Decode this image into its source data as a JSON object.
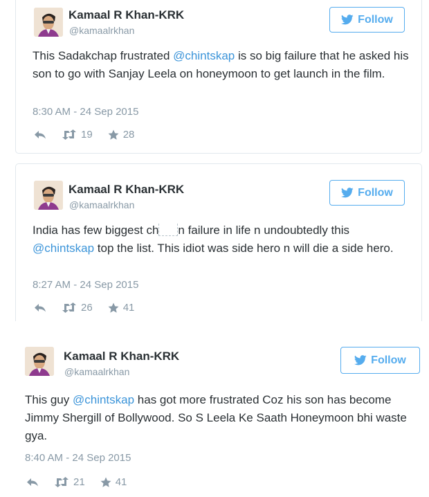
{
  "tweets": [
    {
      "author_name": "Kamaal R Khan-KRK",
      "handle": "@kamaalrkhan",
      "follow_label": "Follow",
      "text_parts": [
        "This Sadakchap frustrated ",
        "@chintskap",
        " is so big failure that he asked his son to go with Sanjay Leela on honeymoon to get launch in the film."
      ],
      "timestamp": "8:30 AM - 24 Sep 2015",
      "retweets": "19",
      "favorites": "28"
    },
    {
      "author_name": "Kamaal R Khan-KRK",
      "handle": "@kamaalrkhan",
      "follow_label": "Follow",
      "text_parts": [
        "India has few biggest ch",
        "n failure in life n undoubtedly this ",
        "@chintskap",
        " top the list. This idiot was side hero n will die a side hero."
      ],
      "timestamp": "8:27 AM - 24 Sep 2015",
      "retweets": "26",
      "favorites": "41"
    },
    {
      "author_name": "Kamaal R Khan-KRK",
      "handle": "@kamaalrkhan",
      "follow_label": "Follow",
      "text_parts": [
        "This guy ",
        "@chintskap",
        " has got more frustrated Coz his son has become Jimmy Shergill of Bollywood. So S Leela Ke Saath Honeymoon bhi waste gya."
      ],
      "timestamp": "8:40 AM - 24 Sep 2015",
      "retweets": "21",
      "favorites": "41"
    }
  ],
  "icons": {
    "reply": "reply-arrow-icon",
    "retweet": "retweet-icon",
    "favorite": "star-icon",
    "follow": "twitter-bird-icon"
  },
  "colors": {
    "accent": "#55acee",
    "mention": "#3b94d9",
    "muted": "#8899a6",
    "text": "#292f33"
  }
}
